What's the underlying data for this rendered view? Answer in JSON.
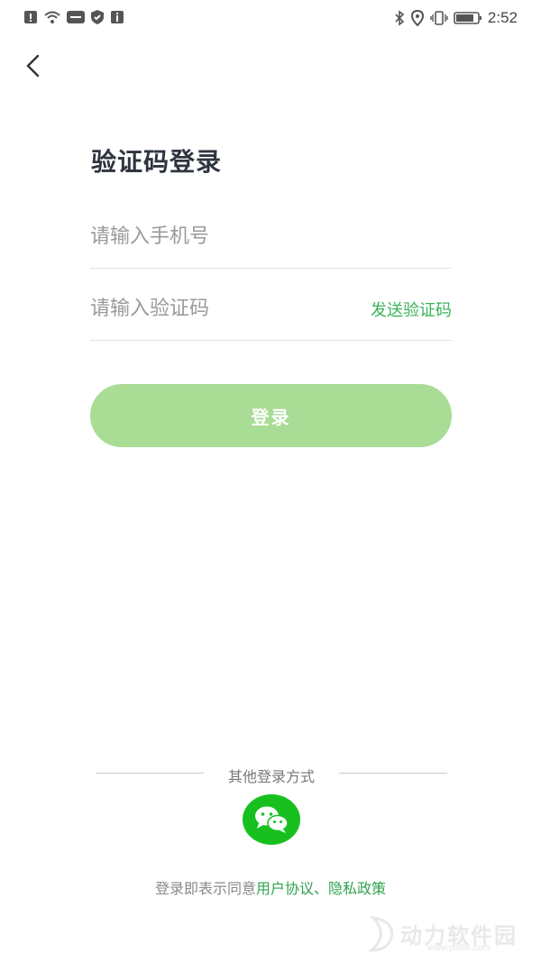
{
  "status_bar": {
    "time": "2:52",
    "left_icons": [
      "alert-icon",
      "wifi-icon",
      "app-badge-icon",
      "shield-icon",
      "info-icon"
    ],
    "right_icons": [
      "bluetooth-icon",
      "location-icon",
      "vibrate-icon",
      "battery-icon"
    ]
  },
  "page": {
    "title": "验证码登录"
  },
  "form": {
    "phone_placeholder": "请输入手机号",
    "code_placeholder": "请输入验证码",
    "send_code_label": "发送验证码",
    "login_label": "登录"
  },
  "other_login": {
    "label": "其他登录方式",
    "wechat_icon": "wechat-icon"
  },
  "agreement": {
    "prefix": "登录即表示同意",
    "user_agreement": "用户协议",
    "separator": "、",
    "privacy_policy": "隐私政策"
  },
  "watermark": {
    "text": "动力软件园",
    "url": "www.pw88.com"
  },
  "colors": {
    "accent_green": "#3bb25a",
    "button_green_disabled": "#a9dc95",
    "wechat_green": "#18c01f"
  }
}
